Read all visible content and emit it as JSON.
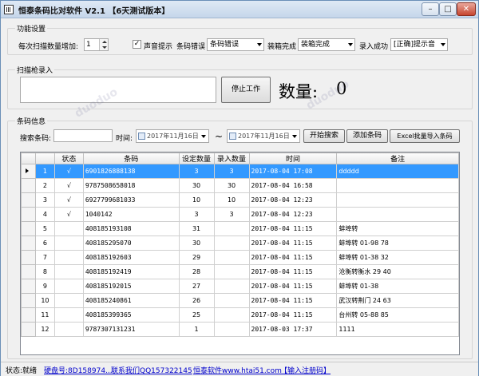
{
  "window": {
    "title": "恒泰条码比对软件 V2.1 【6天测试版本】"
  },
  "settings": {
    "group_title": "功能设置",
    "scan_increment_label": "每次扫描数量增加:",
    "scan_increment_value": "1",
    "sound_checkbox_label": "声音提示",
    "sound_checked": true,
    "barcode_error_label": "条码错误",
    "barcode_error_value": "条码错误",
    "pack_complete_label": "装箱完成",
    "pack_complete_value": "装箱完成",
    "entry_success_label": "录入成功",
    "entry_success_value": "[正确]提示音"
  },
  "scan": {
    "group_title": "扫描枪录入",
    "input_value": "",
    "stop_button": "停止工作",
    "count_label": "数量:",
    "count_value": "0"
  },
  "barcode_info": {
    "group_title": "条码信息",
    "search_label": "搜索条码:",
    "search_value": "",
    "time_label": "时间:",
    "date_from": "2017年11月16日",
    "tilde": "~",
    "date_to": "2017年11月16日",
    "start_search_button": "开始搜索",
    "add_barcode_button": "添加条码",
    "excel_import_button": "Excel批量导入条码"
  },
  "table": {
    "columns": [
      "状态",
      "条码",
      "设定数量",
      "录入数量",
      "时间",
      "备注"
    ],
    "rows": [
      {
        "n": "1",
        "status": "√",
        "code": "6901826888138",
        "set": "3",
        "entered": "3",
        "time": "2017-08-04 17:08",
        "note": "ddddd"
      },
      {
        "n": "2",
        "status": "√",
        "code": "9787508658018",
        "set": "30",
        "entered": "30",
        "time": "2017-08-04 16:58",
        "note": ""
      },
      {
        "n": "3",
        "status": "√",
        "code": "6927799681033",
        "set": "10",
        "entered": "10",
        "time": "2017-08-04 12:23",
        "note": ""
      },
      {
        "n": "4",
        "status": "√",
        "code": "1040142",
        "set": "3",
        "entered": "3",
        "time": "2017-08-04 12:23",
        "note": ""
      },
      {
        "n": "5",
        "status": "",
        "code": "408185193108",
        "set": "31",
        "entered": "",
        "time": "2017-08-04 11:15",
        "note": "蚌埠转"
      },
      {
        "n": "6",
        "status": "",
        "code": "408185295070",
        "set": "30",
        "entered": "",
        "time": "2017-08-04 11:15",
        "note": "蚌埠转 01-98 78"
      },
      {
        "n": "7",
        "status": "",
        "code": "408185192603",
        "set": "29",
        "entered": "",
        "time": "2017-08-04 11:15",
        "note": "蚌埠转 01-38 32"
      },
      {
        "n": "8",
        "status": "",
        "code": "408185192419",
        "set": "28",
        "entered": "",
        "time": "2017-08-04 11:15",
        "note": "沧衡转衡水 29 40"
      },
      {
        "n": "9",
        "status": "",
        "code": "408185192015",
        "set": "27",
        "entered": "",
        "time": "2017-08-04 11:15",
        "note": "蚌埠转 01-38"
      },
      {
        "n": "10",
        "status": "",
        "code": "408185240861",
        "set": "26",
        "entered": "",
        "time": "2017-08-04 11:15",
        "note": "武汉转荆门 24 63"
      },
      {
        "n": "11",
        "status": "",
        "code": "408185399365",
        "set": "25",
        "entered": "",
        "time": "2017-08-04 11:15",
        "note": "台州转 05-88 85"
      },
      {
        "n": "12",
        "status": "",
        "code": "9787307131231",
        "set": "1",
        "entered": "",
        "time": "2017-08-03 17:37",
        "note": "1111"
      }
    ]
  },
  "status_bar": {
    "state": "状态:就绪",
    "disk": "硬盘号:8D158974...",
    "contact": "联系我们QQ157322145",
    "website": "恒泰软件www.htai51.com",
    "register": "【输入注册码】"
  }
}
